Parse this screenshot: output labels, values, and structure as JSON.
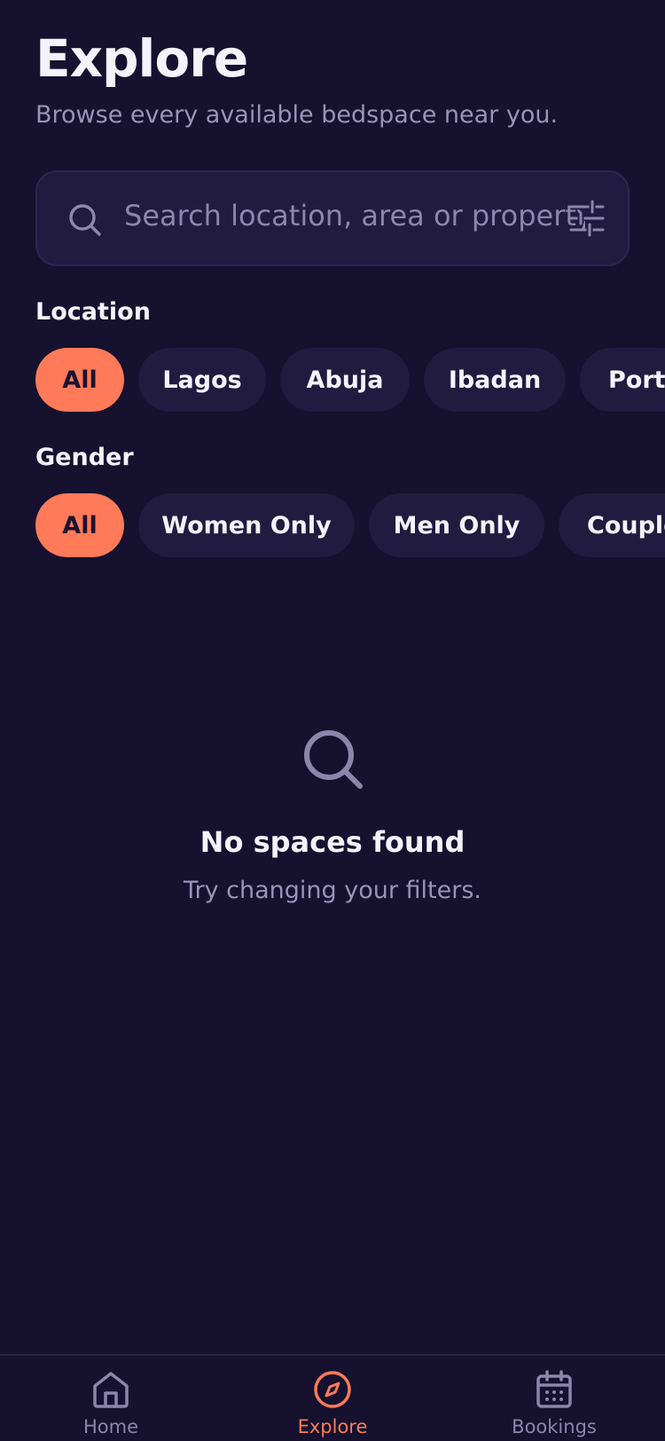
{
  "header": {
    "title": "Explore",
    "subtitle": "Browse every available bedspace near you."
  },
  "search": {
    "placeholder": "Search location, area or property",
    "search_icon": "search-icon",
    "filter_icon": "sliders-icon"
  },
  "location": {
    "label": "Location",
    "chips": [
      "All",
      "Lagos",
      "Abuja",
      "Ibadan",
      "Port"
    ],
    "selected": "All"
  },
  "gender": {
    "label": "Gender",
    "chips": [
      "All",
      "Women Only",
      "Men Only",
      "Couple"
    ],
    "selected": "All"
  },
  "empty_state": {
    "icon": "search-icon",
    "title": "No spaces found",
    "subtitle": "Try changing your filters."
  },
  "tabbar": {
    "items": [
      {
        "label": "Home",
        "icon": "home-icon"
      },
      {
        "label": "Explore",
        "icon": "compass-icon"
      },
      {
        "label": "Bookings",
        "icon": "calendar-icon"
      }
    ],
    "active": "Explore"
  },
  "colors": {
    "background": "#15112e",
    "surface": "#201b3f",
    "accent": "#ff7a59",
    "muted_text": "#9a93b8"
  }
}
